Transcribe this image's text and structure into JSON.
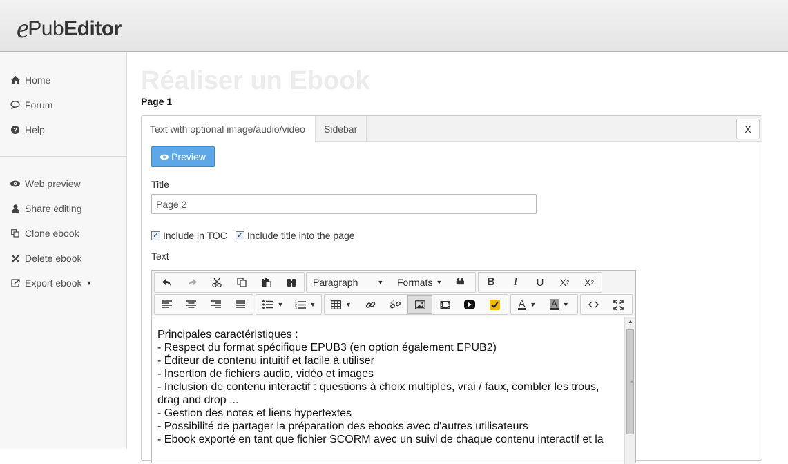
{
  "header": {
    "logo_e": "e",
    "logo_pub": "Pub",
    "logo_editor": "Editor"
  },
  "sidebar": {
    "items": [
      {
        "label": "Home",
        "icon": "home-icon"
      },
      {
        "label": "Forum",
        "icon": "comment-icon"
      },
      {
        "label": "Help",
        "icon": "question-icon"
      },
      {
        "label": "Web preview",
        "icon": "eye-icon"
      },
      {
        "label": "Share editing",
        "icon": "user-icon"
      },
      {
        "label": "Clone ebook",
        "icon": "copy-icon"
      },
      {
        "label": "Delete ebook",
        "icon": "x-icon"
      },
      {
        "label": "Export ebook",
        "icon": "export-icon"
      }
    ]
  },
  "main": {
    "title": "Réaliser un Ebook",
    "subtitle": "Page 1",
    "tabs": [
      {
        "label": "Text with optional image/audio/video"
      },
      {
        "label": "Sidebar"
      }
    ],
    "close_label": "X",
    "preview_label": "Preview",
    "title_label": "Title",
    "title_value": "Page 2",
    "include_toc_label": "Include in TOC",
    "include_title_label": "Include title into the page",
    "text_label": "Text"
  },
  "editor": {
    "paragraph_label": "Paragraph",
    "formats_label": "Formats",
    "lines": [
      "Principales caractéristiques :",
      "- Respect du format spécifique EPUB3 (en option également EPUB2)",
      "- Éditeur de contenu intuitif et facile à utiliser",
      "- Insertion de fichiers audio, vidéo et images",
      "- Inclusion de contenu interactif : questions à choix multiples, vrai / faux, combler les trous, drag and drop ...",
      "- Gestion des notes et liens hypertextes",
      "- Possibilité de partager la préparation des ebooks avec d'autres utilisateurs",
      "- Ebook exporté en tant que fichier SCORM avec un suivi de chaque contenu interactif et la"
    ]
  },
  "colors": {
    "accent": "#5fa8e8",
    "title_faded": "#ececec"
  }
}
